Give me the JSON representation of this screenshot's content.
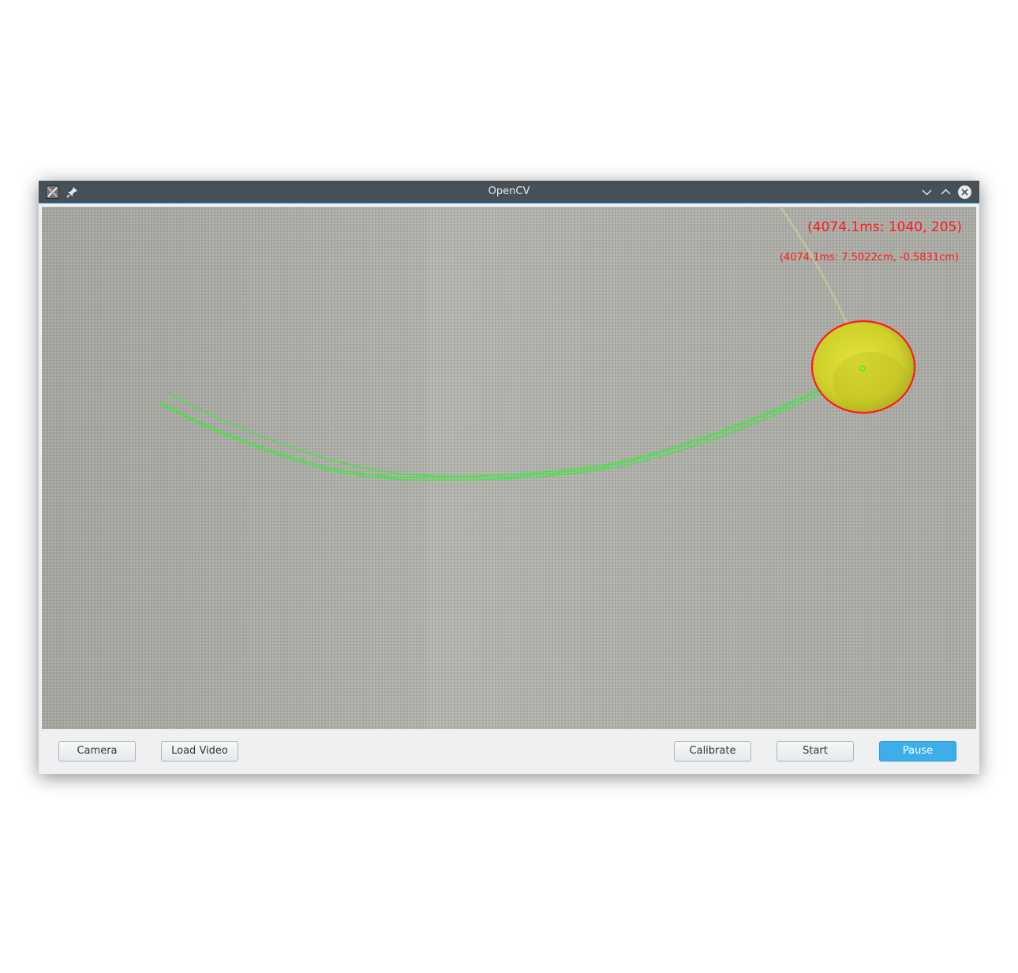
{
  "window": {
    "title": "OpenCV"
  },
  "titlebar": {
    "app_icon": "x-app-icon",
    "pin_icon": "pin-icon",
    "minimize_icon": "chevron-down-icon",
    "maximize_icon": "chevron-up-icon",
    "close_icon": "close-icon"
  },
  "video": {
    "pixel_readout": "(4074.1ms: 1040, 205)",
    "cm_readout": "(4074.1ms: 7.5022cm, -0.5831cm)",
    "tracking_color": "#ff1a1a",
    "trajectory_color": "#33ee33",
    "object_color": "#d8da2a"
  },
  "toolbar": {
    "camera_label": "Camera",
    "load_video_label": "Load Video",
    "calibrate_label": "Calibrate",
    "start_label": "Start",
    "pause_label": "Pause"
  },
  "colors": {
    "titlebar": "#475057",
    "accent": "#3daee9",
    "window_bg": "#eff0f1"
  }
}
